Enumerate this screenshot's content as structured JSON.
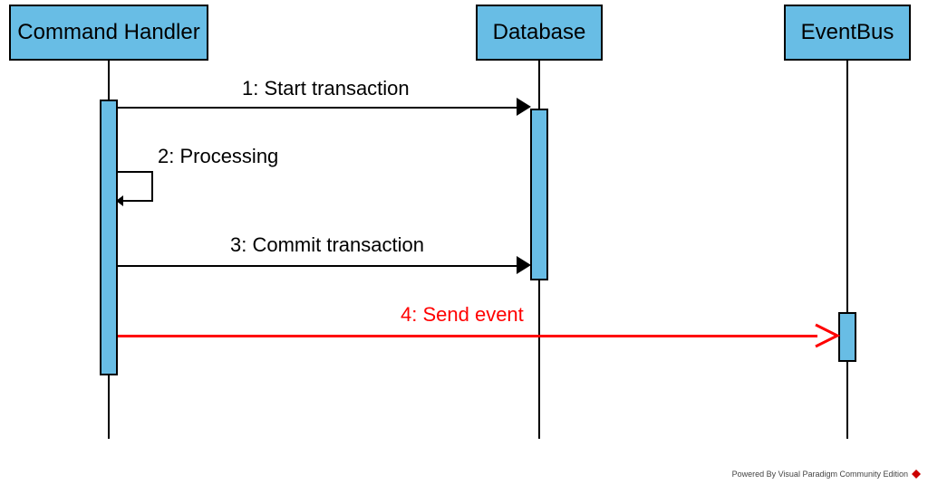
{
  "chart_data": {
    "type": "sequence-diagram",
    "participants": [
      {
        "id": "cmd",
        "label": "Command Handler"
      },
      {
        "id": "db",
        "label": "Database"
      },
      {
        "id": "bus",
        "label": "EventBus"
      }
    ],
    "messages": [
      {
        "n": 1,
        "from": "cmd",
        "to": "db",
        "label": "1: Start transaction",
        "style": "solid",
        "color": "black"
      },
      {
        "n": 2,
        "from": "cmd",
        "to": "cmd",
        "label": "2: Processing",
        "style": "self",
        "color": "black"
      },
      {
        "n": 3,
        "from": "cmd",
        "to": "db",
        "label": "3: Commit transaction",
        "style": "solid",
        "color": "black"
      },
      {
        "n": 4,
        "from": "cmd",
        "to": "bus",
        "label": "4: Send event",
        "style": "open",
        "color": "red"
      }
    ],
    "activations": [
      {
        "participant": "cmd",
        "spans_messages": [
          1,
          4
        ]
      },
      {
        "participant": "db",
        "spans_messages": [
          1,
          3
        ]
      },
      {
        "participant": "bus",
        "spans_messages": [
          4,
          4
        ]
      }
    ],
    "colors": {
      "participant_fill": "#68bde5",
      "highlight": "#ff0000"
    }
  },
  "labels": {
    "p1": "Command Handler",
    "p2": "Database",
    "p3": "EventBus",
    "m1": "1: Start transaction",
    "m2": "2: Processing",
    "m3": "3: Commit transaction",
    "m4": "4: Send event"
  },
  "footer": {
    "text": "Powered By Visual Paradigm Community Edition"
  }
}
